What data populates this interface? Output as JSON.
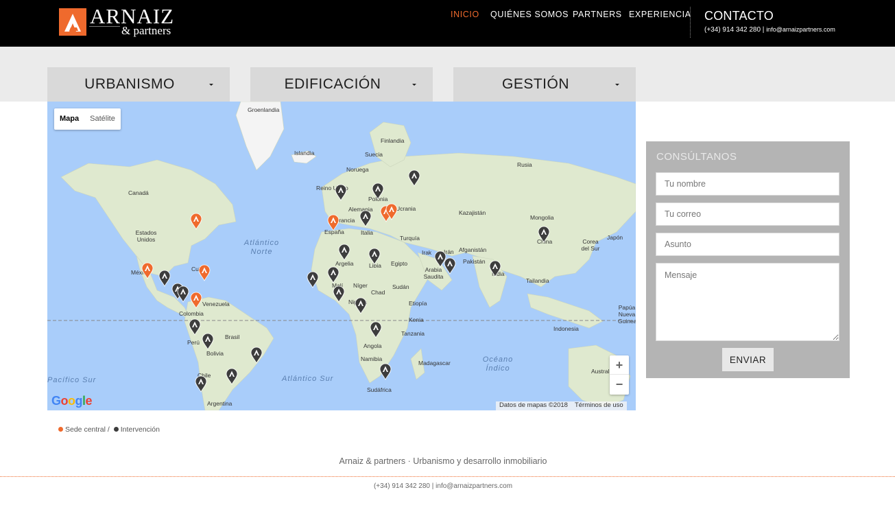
{
  "header": {
    "logo_name": "ARNAIZ",
    "logo_sub": "& partners",
    "nav": [
      "INICIO",
      "QUIÉNES SOMOS",
      "PARTNERS",
      "EXPERIENCIA"
    ],
    "contact_title": "CONTACTO",
    "contact_phone": "(+34) 914 342 280",
    "contact_separator": "|",
    "contact_email": "info@arnaizpartners.com",
    "accent_color": "#ef6a2d"
  },
  "menus": [
    "URBANISMO",
    "EDIFICACIÓN",
    "GESTIÓN"
  ],
  "map": {
    "type_buttons": [
      "Mapa",
      "Satélite"
    ],
    "labels": [
      "Groenlandia",
      "Islandia",
      "Finlandia",
      "Suecia",
      "Noruega",
      "Rusia",
      "Canadá",
      "Reino Unido",
      "Polonia",
      "Ucrania",
      "Alemania",
      "Francia",
      "España",
      "Italia",
      "Kazajistán",
      "Mongolia",
      "Estados Unidos",
      "Turquía",
      "Irak",
      "Irán",
      "Afganistán",
      "Pakistán",
      "China",
      "Corea del Sur",
      "Japón",
      "México",
      "Cuba",
      "Argelia",
      "Libia",
      "Egipto",
      "Arabia Saudita",
      "India",
      "Tailandia",
      "Venezuela",
      "Colombia",
      "Malí",
      "Níger",
      "Chad",
      "Sudán",
      "Etiopía",
      "Nigeria",
      "Kenia",
      "Tanzania",
      "Perú",
      "Brasil",
      "Bolivia",
      "Angola",
      "Namibia",
      "Madagascar",
      "Indonesia",
      "Papúa Nueva Guinea",
      "Chile",
      "Argentina",
      "Sudáfrica",
      "Australia"
    ],
    "oceans": [
      "Atlántico Norte",
      "Atlántico Sur",
      "Pacífico Sur",
      "Océano Índico"
    ],
    "zoom_in": "+",
    "zoom_out": "−",
    "google": "Google",
    "attribution": [
      "Datos de mapas ©2018",
      "Términos de uso"
    ],
    "pin_colors": {
      "sede": "#ef6a2d",
      "intervencion": "#3d3d3d"
    }
  },
  "legend": {
    "sede": "Sede central /",
    "intervencion": "Intervención"
  },
  "form": {
    "title": "CONSÚLTANOS",
    "name_placeholder": "Tu nombre",
    "email_placeholder": "Tu correo",
    "subject_placeholder": "Asunto",
    "message_placeholder": "Mensaje",
    "send_label": "ENVIAR"
  },
  "footer": {
    "tagline": "Arnaiz & partners · Urbanismo y desarrollo inmobiliario",
    "phone": "(+34) 914 342 280",
    "separator": "|",
    "email": "info@arnaizpartners.com"
  }
}
